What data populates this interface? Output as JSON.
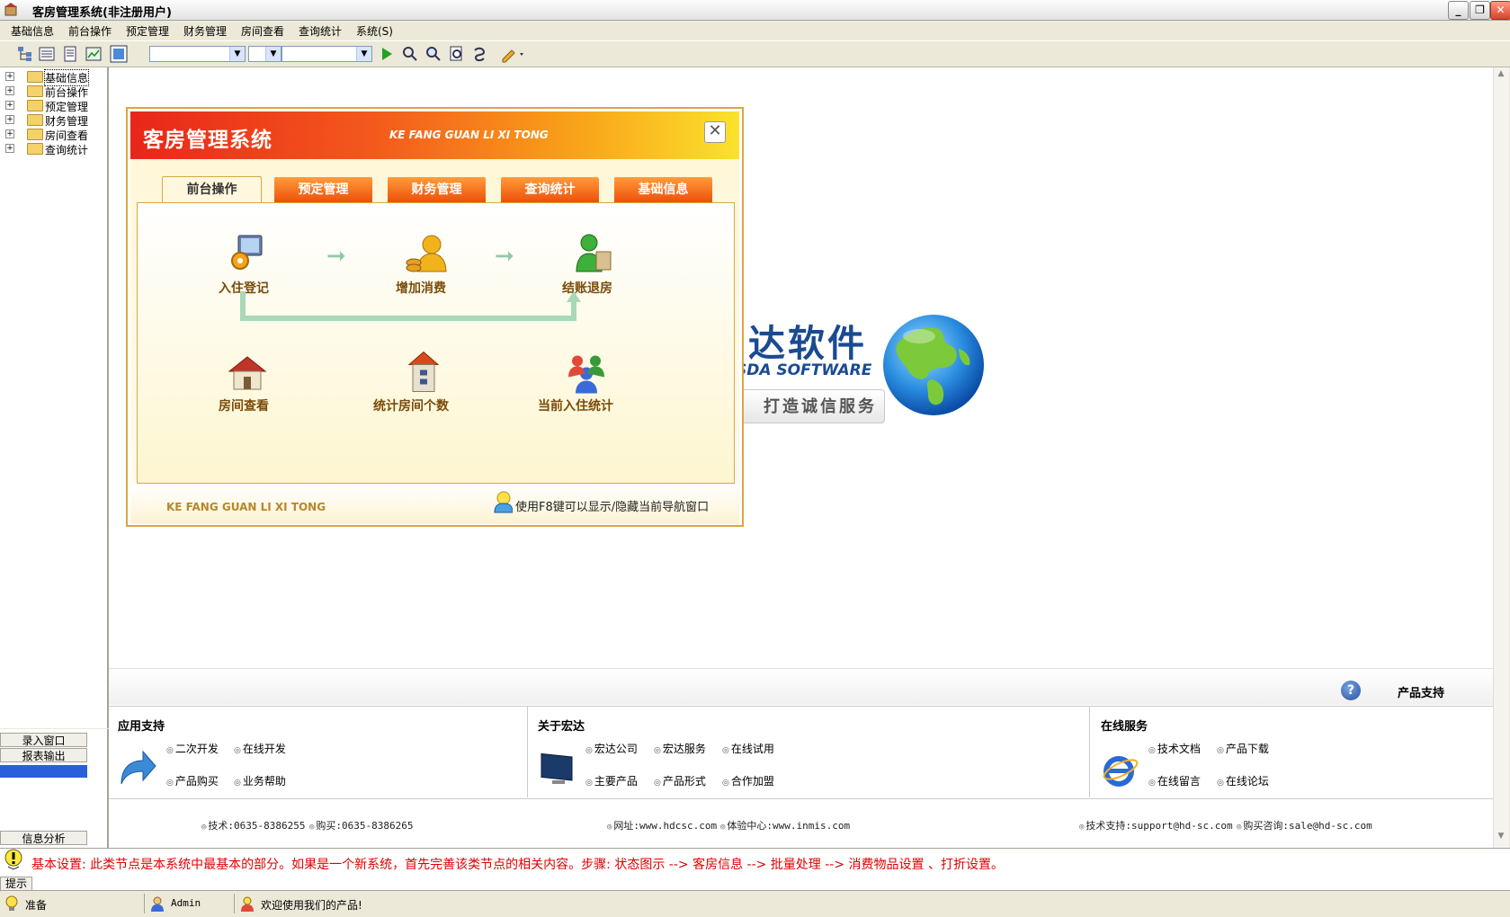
{
  "window": {
    "title": "客房管理系统(非注册用户)",
    "controls": [
      "_",
      "❐",
      "✕"
    ]
  },
  "menu": [
    "基础信息",
    "前台操作",
    "预定管理",
    "财务管理",
    "房间查看",
    "查询统计",
    "系统(S)"
  ],
  "tree": {
    "root": "基础信息",
    "items": [
      "前台操作",
      "预定管理",
      "财务管理",
      "房间查看",
      "查询统计"
    ]
  },
  "left_panel_buttons": {
    "entry": "录入窗口",
    "report": "报表输出",
    "analysis": "信息分析"
  },
  "dialog": {
    "title": "客房管理系统",
    "pinyin": "KE FANG GUAN LI XI TONG",
    "tabs": [
      "前台操作",
      "预定管理",
      "财务管理",
      "查询统计",
      "基础信息"
    ],
    "active_tab": "前台操作",
    "nodes": {
      "checkin": "入住登记",
      "add_consume": "增加消费",
      "checkout": "结账退房",
      "room_view": "房间查看",
      "room_count": "统计房间个数",
      "current_stats": "当前入住统计"
    },
    "footer_pinyin": "KE FANG GUAN LI XI TONG",
    "footer_hint": "使用F8键可以显示/隐藏当前导航窗口"
  },
  "logo": {
    "cn": "达软件",
    "en": "SDA SOFTWARE",
    "slogan": "打造诚信服务"
  },
  "support": {
    "label": "产品支持",
    "app_support": {
      "title": "应用支持",
      "links": [
        "二次开发",
        "在线开发",
        "产品购买",
        "业务帮助"
      ]
    },
    "about": {
      "title": "关于宏达",
      "links": [
        "宏达公司",
        "宏达服务",
        "在线试用",
        "主要产品",
        "产品形式",
        "合作加盟"
      ]
    },
    "online": {
      "title": "在线服务",
      "links": [
        "技术文档",
        "产品下载",
        "在线留言",
        "在线论坛"
      ]
    },
    "contacts": [
      "技术:0635-8386255",
      "购买:0635-8386265",
      "网址:www.hdcsc.com",
      "体验中心:www.inmis.com",
      "技术支持:support@hd-sc.com",
      "购买咨询:sale@hd-sc.com"
    ]
  },
  "hint": {
    "tab_label": "提示",
    "text": "基本设置: 此类节点是本系统中最基本的部分。如果是一个新系统，首先完善该类节点的相关内容。步骤: 状态图示 --> 客房信息 --> 批量处理 --> 消费物品设置 、打折设置。"
  },
  "status": {
    "ready": "准备",
    "user": "Admin",
    "welcome": "欢迎使用我们的产品!"
  }
}
